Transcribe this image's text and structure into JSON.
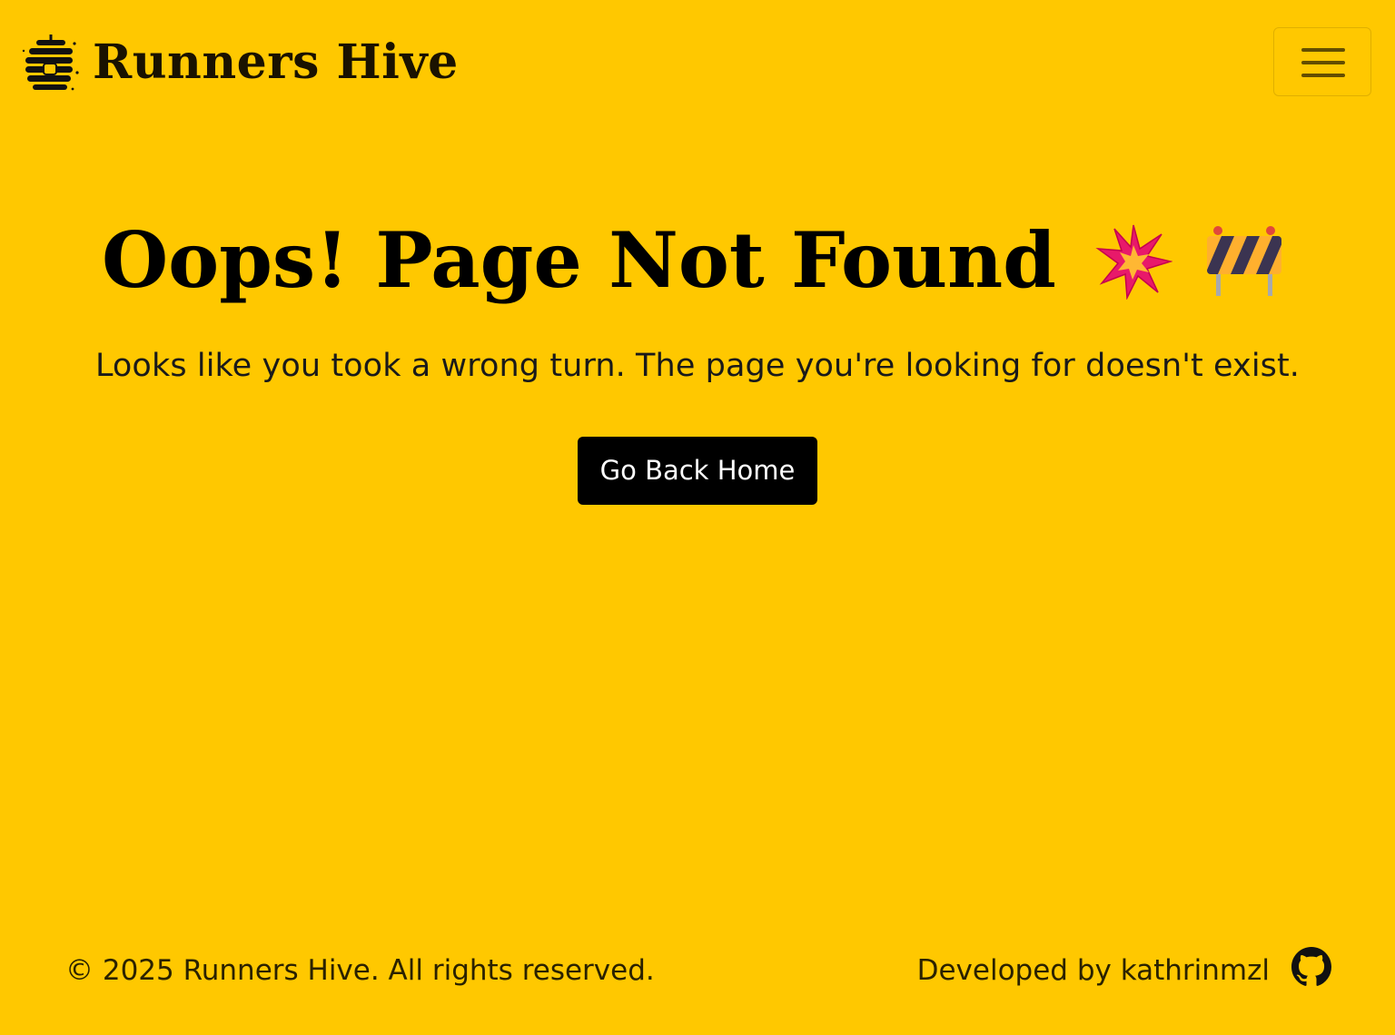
{
  "navbar": {
    "brand_name": "Runners Hive",
    "logo_icon": "beehive-icon",
    "menu_icon": "hamburger-menu-icon"
  },
  "main": {
    "title": "Oops! Page Not Found",
    "title_emojis": [
      "collision-icon",
      "construction-barrier-icon"
    ],
    "subtitle": "Looks like you took a wrong turn. The page you're looking for doesn't exist.",
    "home_button_label": "Go Back Home"
  },
  "footer": {
    "copyright": "© 2025 Runners Hive. All rights reserved.",
    "developer": "Developed by kathrinmzl",
    "github_icon": "github-icon"
  },
  "colors": {
    "background": "#ffc800",
    "button_bg": "#000000",
    "button_text": "#ffffff",
    "text": "#000000"
  }
}
